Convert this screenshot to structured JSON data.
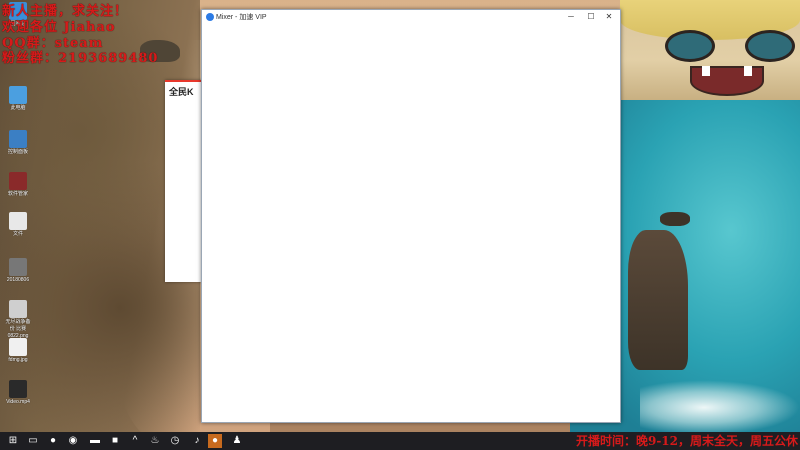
{
  "overlay": {
    "lines": [
      "新人主播，求关注！",
      "欢迎各位 Jiahao",
      "QQ群：steam",
      "粉丝群：2193689480"
    ]
  },
  "desktop_icons": [
    {
      "label": "回收站",
      "color": "#3a8fd9"
    },
    {
      "label": "此电脑",
      "color": "#4b9fe0"
    },
    {
      "label": "控制面板",
      "color": "#3b7fc4"
    },
    {
      "label": "软件管家",
      "color": "#8a2a2a"
    },
    {
      "label": "文件",
      "color": "#e8e8e8"
    },
    {
      "label": "20180806",
      "color": "#777777"
    },
    {
      "label": "无尽战争备份\n比赛0822.png",
      "color": "#cfcfcf"
    },
    {
      "label": "fdmg.jpg",
      "color": "#f0f0f0"
    },
    {
      "label": "Video.mp4",
      "color": "#2a2a2a"
    }
  ],
  "background_window": {
    "title": "全民K"
  },
  "main_window": {
    "title": "Mixer - 加速 VIP",
    "minimize": "─",
    "maximize": "☐",
    "close": "✕"
  },
  "taskbar": {
    "items": [
      {
        "name": "start",
        "glyph": "⊞"
      },
      {
        "name": "task-view",
        "glyph": "▭"
      },
      {
        "name": "app-red",
        "glyph": "●"
      },
      {
        "name": "chrome",
        "glyph": "◉"
      },
      {
        "name": "explorer",
        "glyph": "▬"
      },
      {
        "name": "app-yellow",
        "glyph": "■"
      },
      {
        "name": "arrow",
        "glyph": "^"
      },
      {
        "name": "steam",
        "glyph": "♨"
      },
      {
        "name": "clock",
        "glyph": "◷"
      },
      {
        "name": "netease",
        "glyph": "♪"
      },
      {
        "name": "active-app",
        "glyph": "●"
      },
      {
        "name": "app-person",
        "glyph": "♟"
      }
    ],
    "marquee": "开播时间：晚9-12，周末全天，周五公休"
  },
  "colors": {
    "overlay_red": "#d71a1a",
    "taskbar_bg": "#1e1e22",
    "active_taskbar": "#c86a1e"
  }
}
